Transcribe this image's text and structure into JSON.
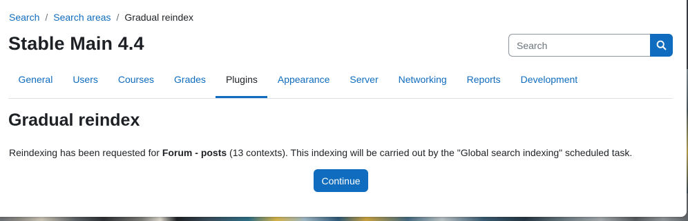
{
  "breadcrumb": {
    "items": [
      {
        "label": "Search"
      },
      {
        "label": "Search areas"
      }
    ],
    "current": "Gradual reindex",
    "separator": "/"
  },
  "header": {
    "site_title": "Stable Main 4.4"
  },
  "search": {
    "placeholder": "Search",
    "icon": "search-icon",
    "button_color": "#0f6cbf"
  },
  "tabs": [
    {
      "label": "General"
    },
    {
      "label": "Users"
    },
    {
      "label": "Courses"
    },
    {
      "label": "Grades"
    },
    {
      "label": "Plugins",
      "active": true
    },
    {
      "label": "Appearance"
    },
    {
      "label": "Server"
    },
    {
      "label": "Networking"
    },
    {
      "label": "Reports"
    },
    {
      "label": "Development"
    }
  ],
  "main": {
    "heading": "Gradual reindex",
    "message": {
      "prefix": "Reindexing has been requested for ",
      "area": "Forum - posts",
      "suffix": " (13 contexts). This indexing will be carried out by the \"Global search indexing\" scheduled task."
    },
    "continue_label": "Continue"
  },
  "colors": {
    "accent": "#0f6cbf",
    "text": "#1d2125"
  }
}
